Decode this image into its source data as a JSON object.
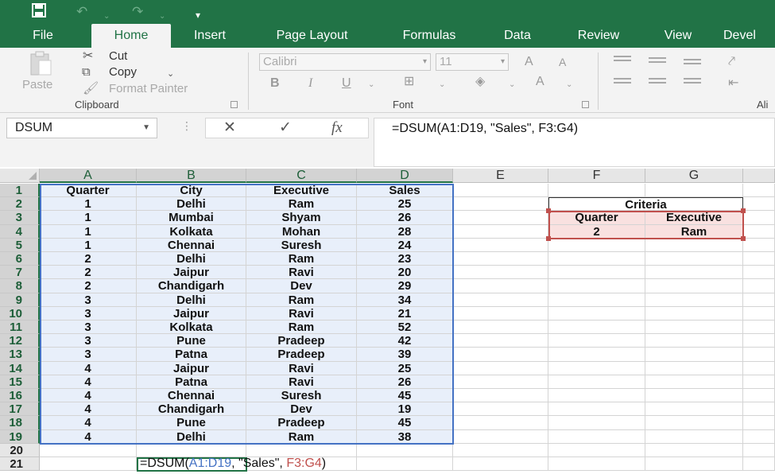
{
  "quick_access": {
    "save_icon": "save-icon",
    "undo_icon": "undo-icon",
    "redo_icon": "redo-icon",
    "customize_icon": "customize-icon"
  },
  "tabs": [
    "File",
    "Home",
    "Insert",
    "Page Layout",
    "Formulas",
    "Data",
    "Review",
    "View",
    "Devel"
  ],
  "ribbon": {
    "clipboard": {
      "paste": "Paste",
      "cut": "Cut",
      "copy": "Copy",
      "format_painter": "Format Painter",
      "label": "Clipboard"
    },
    "font": {
      "name": "Calibri",
      "size": "11",
      "bold": "B",
      "italic": "I",
      "underline": "U",
      "grow": "A",
      "shrink": "A",
      "color": "A",
      "label": "Font"
    },
    "alignment": {
      "label": "Ali"
    }
  },
  "formula_bar": {
    "name_box": "DSUM",
    "cancel": "✕",
    "enter": "✓",
    "fx": "fx",
    "formula": "=DSUM(A1:D19, \"Sales\", F3:G4)"
  },
  "columns": [
    "A",
    "B",
    "C",
    "D",
    "E",
    "F",
    "G"
  ],
  "rows": [
    "1",
    "2",
    "3",
    "4",
    "5",
    "6",
    "7",
    "8",
    "9",
    "10",
    "11",
    "12",
    "13",
    "14",
    "15",
    "16",
    "17",
    "18",
    "19",
    "20",
    "21"
  ],
  "table": {
    "headers": [
      "Quarter",
      "City",
      "Executive",
      "Sales"
    ],
    "data": [
      [
        "1",
        "Delhi",
        "Ram",
        "25"
      ],
      [
        "1",
        "Mumbai",
        "Shyam",
        "26"
      ],
      [
        "1",
        "Kolkata",
        "Mohan",
        "28"
      ],
      [
        "1",
        "Chennai",
        "Suresh",
        "24"
      ],
      [
        "2",
        "Delhi",
        "Ram",
        "23"
      ],
      [
        "2",
        "Jaipur",
        "Ravi",
        "20"
      ],
      [
        "2",
        "Chandigarh",
        "Dev",
        "29"
      ],
      [
        "3",
        "Delhi",
        "Ram",
        "34"
      ],
      [
        "3",
        "Jaipur",
        "Ravi",
        "21"
      ],
      [
        "3",
        "Kolkata",
        "Ram",
        "52"
      ],
      [
        "3",
        "Pune",
        "Pradeep",
        "42"
      ],
      [
        "3",
        "Patna",
        "Pradeep",
        "39"
      ],
      [
        "4",
        "Jaipur",
        "Ravi",
        "25"
      ],
      [
        "4",
        "Patna",
        "Ravi",
        "26"
      ],
      [
        "4",
        "Chennai",
        "Suresh",
        "45"
      ],
      [
        "4",
        "Chandigarh",
        "Dev",
        "19"
      ],
      [
        "4",
        "Pune",
        "Pradeep",
        "45"
      ],
      [
        "4",
        "Delhi",
        "Ram",
        "38"
      ]
    ]
  },
  "criteria": {
    "title": "Criteria",
    "headers": [
      "Quarter",
      "Executive"
    ],
    "values": [
      "2",
      "Ram"
    ]
  },
  "cell_b21": {
    "prefix": "=DSUM(",
    "ref1": "A1:D19",
    "middle": ", \"Sales\", ",
    "ref2": "F3:G4",
    "suffix": ")"
  },
  "colors": {
    "excel_green": "#217346",
    "range_blue": "#4472c4",
    "range_red": "#c0504d",
    "selection_fill": "#e8effa"
  }
}
